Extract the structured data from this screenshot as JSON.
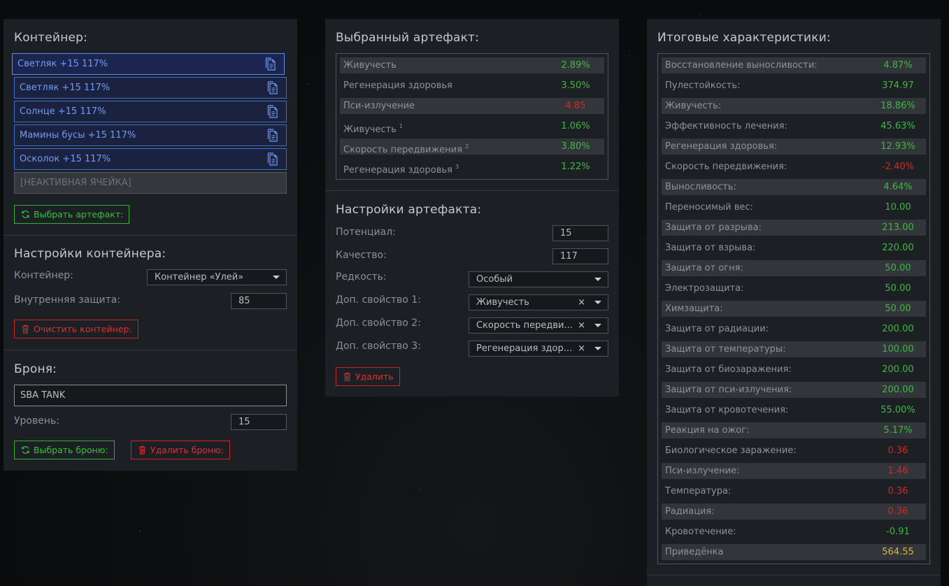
{
  "container_panel": {
    "title": "Контейнер:",
    "slots": [
      {
        "label": "Светляк +15 117%"
      },
      {
        "label": "Светляк +15 117%"
      },
      {
        "label": "Солнце +15 117%"
      },
      {
        "label": "Мамины бусы +15 117%"
      },
      {
        "label": "Осколок +15 117%"
      }
    ],
    "inactive_slot": "[НЕАКТИВНАЯ ЯЧЕЙКА]",
    "choose_artifact_button": "Выбрать артефакт:"
  },
  "container_settings": {
    "title": "Настройки контейнера:",
    "container_label": "Контейнер:",
    "container_value": "Контейнер «Улей»",
    "inner_protection_label": "Внутренняя защита:",
    "inner_protection_value": "85",
    "clear_button": "Очистить контейнер:"
  },
  "armor": {
    "title": "Броня:",
    "name_value": "SBA TANK",
    "level_label": "Уровень:",
    "level_value": "15",
    "choose_button": "Выбрать броню:",
    "delete_button": "Удалить броню:"
  },
  "selected_artifact": {
    "title": "Выбранный артефакт:",
    "stats": [
      {
        "name": "Живучесть",
        "sup": "",
        "value": "2.89%",
        "tone": "pos"
      },
      {
        "name": "Регенерация здоровья",
        "sup": "",
        "value": "3.50%",
        "tone": "pos"
      },
      {
        "name": "Пси-излучение",
        "sup": "",
        "value": "4.85",
        "tone": "neg"
      },
      {
        "name": "Живучесть ",
        "sup": "1",
        "value": "1.06%",
        "tone": "pos"
      },
      {
        "name": "Скорость передвижения ",
        "sup": "2",
        "value": "3.80%",
        "tone": "pos"
      },
      {
        "name": "Регенерация здоровья ",
        "sup": "3",
        "value": "1.22%",
        "tone": "pos"
      }
    ]
  },
  "artifact_settings": {
    "title": "Настройки артефакта:",
    "potential_label": "Потенциал:",
    "potential_value": "15",
    "quality_label": "Качество:",
    "quality_value": "117",
    "rarity_label": "Редкость:",
    "rarity_value": "Особый",
    "extra1_label": "Доп. свойство 1:",
    "extra1_value": "Живучесть",
    "extra2_label": "Доп. свойство 2:",
    "extra2_value": "Скорость передви...",
    "extra3_label": "Доп. свойство 3:",
    "extra3_value": "Регенерация здор...",
    "clear_glyph": "×",
    "delete_button": "Удалить"
  },
  "totals": {
    "title": "Итоговые характеристики:",
    "stats": [
      {
        "name": "Восстановление выносливости:",
        "value": "4.87%",
        "tone": "pos"
      },
      {
        "name": "Пулестойкость:",
        "value": "374.97",
        "tone": "pos"
      },
      {
        "name": "Живучесть:",
        "value": "18.86%",
        "tone": "pos"
      },
      {
        "name": "Эффективность лечения:",
        "value": "45.63%",
        "tone": "pos"
      },
      {
        "name": "Регенерация здоровья:",
        "value": "12.93%",
        "tone": "pos"
      },
      {
        "name": "Скорость передвижения:",
        "value": "-2.40%",
        "tone": "neg"
      },
      {
        "name": "Выносливость:",
        "value": "4.64%",
        "tone": "pos"
      },
      {
        "name": "Переносимый вес:",
        "value": "10.00",
        "tone": "pos"
      },
      {
        "name": "Защита от разрыва:",
        "value": "213.00",
        "tone": "pos"
      },
      {
        "name": "Защита от взрыва:",
        "value": "220.00",
        "tone": "pos"
      },
      {
        "name": "Защита от огня:",
        "value": "50.00",
        "tone": "pos"
      },
      {
        "name": "Электрозащита:",
        "value": "50.00",
        "tone": "pos"
      },
      {
        "name": "Химзащита:",
        "value": "50.00",
        "tone": "pos"
      },
      {
        "name": "Защита от радиации:",
        "value": "200.00",
        "tone": "pos"
      },
      {
        "name": "Защита от температуры:",
        "value": "100.00",
        "tone": "pos"
      },
      {
        "name": "Защита от биозаражения:",
        "value": "200.00",
        "tone": "pos"
      },
      {
        "name": "Защита от пси-излучения:",
        "value": "200.00",
        "tone": "pos"
      },
      {
        "name": "Защита от кровотечения:",
        "value": "55.00%",
        "tone": "pos"
      },
      {
        "name": "Реакция на ожог:",
        "value": "5.17%",
        "tone": "pos"
      },
      {
        "name": "Биологическое заражение:",
        "value": "0.36",
        "tone": "neg"
      },
      {
        "name": "Пси-излучение:",
        "value": "1.46",
        "tone": "neg"
      },
      {
        "name": "Температура:",
        "value": "0.36",
        "tone": "neg"
      },
      {
        "name": "Радиация:",
        "value": "0.36",
        "tone": "neg"
      },
      {
        "name": "Кровотечение:",
        "value": "-0.91",
        "tone": "pos"
      },
      {
        "name": "Приведёнка",
        "value": "564.55",
        "tone": "gold"
      }
    ]
  },
  "colors": {
    "accent_blue": "#3b6ed6",
    "positive": "#3fb83f",
    "negative": "#d42828",
    "gold": "#e0b53a"
  },
  "icons": {
    "copy": "copy-icon",
    "refresh": "refresh-icon",
    "trash": "trash-icon",
    "caret": "chevron-down-icon"
  }
}
